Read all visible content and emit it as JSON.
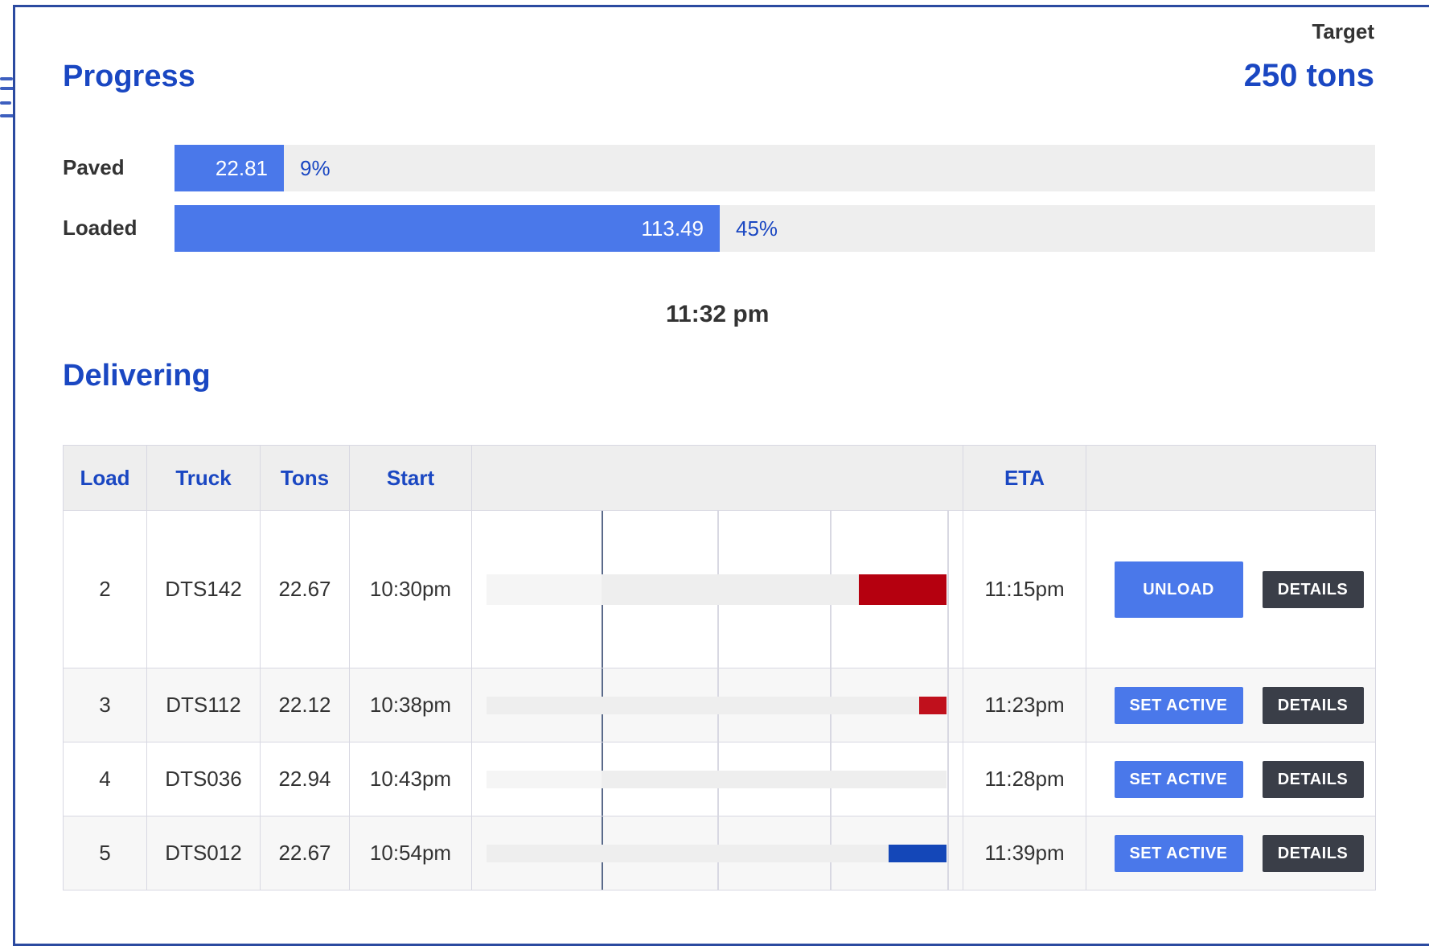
{
  "progress": {
    "title": "Progress",
    "target_label": "Target",
    "target_value": "250 tons",
    "rows": [
      {
        "label": "Paved",
        "value": "22.81",
        "percent": "9%",
        "fraction": 0.0912
      },
      {
        "label": "Loaded",
        "value": "113.49",
        "percent": "45%",
        "fraction": 0.454
      }
    ]
  },
  "current_time": "11:32 pm",
  "delivering": {
    "title": "Delivering",
    "columns": [
      "Load",
      "Truck",
      "Tons",
      "Start",
      "",
      "ETA",
      ""
    ],
    "rows": [
      {
        "load": "2",
        "truck": "DTS142",
        "tons": "22.67",
        "start": "10:30pm",
        "eta": "11:15pm",
        "primary_action": "UNLOAD",
        "secondary_action": "DETAILS",
        "bar_color": "#b5000f",
        "bar_fraction": 0.19,
        "prefill_fraction": 0.25
      },
      {
        "load": "3",
        "truck": "DTS112",
        "tons": "22.12",
        "start": "10:38pm",
        "eta": "11:23pm",
        "primary_action": "SET ACTIVE",
        "secondary_action": "DETAILS",
        "bar_color": "#c0101c",
        "bar_fraction": 0.06,
        "prefill_fraction": 0.0
      },
      {
        "load": "4",
        "truck": "DTS036",
        "tons": "22.94",
        "start": "10:43pm",
        "eta": "11:28pm",
        "primary_action": "SET ACTIVE",
        "secondary_action": "DETAILS",
        "bar_color": "#1a47c2",
        "bar_fraction": 0.0,
        "prefill_fraction": 0.25
      },
      {
        "load": "5",
        "truck": "DTS012",
        "tons": "22.67",
        "start": "10:54pm",
        "eta": "11:39pm",
        "primary_action": "SET ACTIVE",
        "secondary_action": "DETAILS",
        "bar_color": "#1447b8",
        "bar_fraction": 0.125,
        "prefill_fraction": 0.0
      }
    ]
  },
  "colors": {
    "accent": "#1a47c2",
    "bar_fill": "#4a78ea",
    "button_dark": "#3a3e48"
  }
}
